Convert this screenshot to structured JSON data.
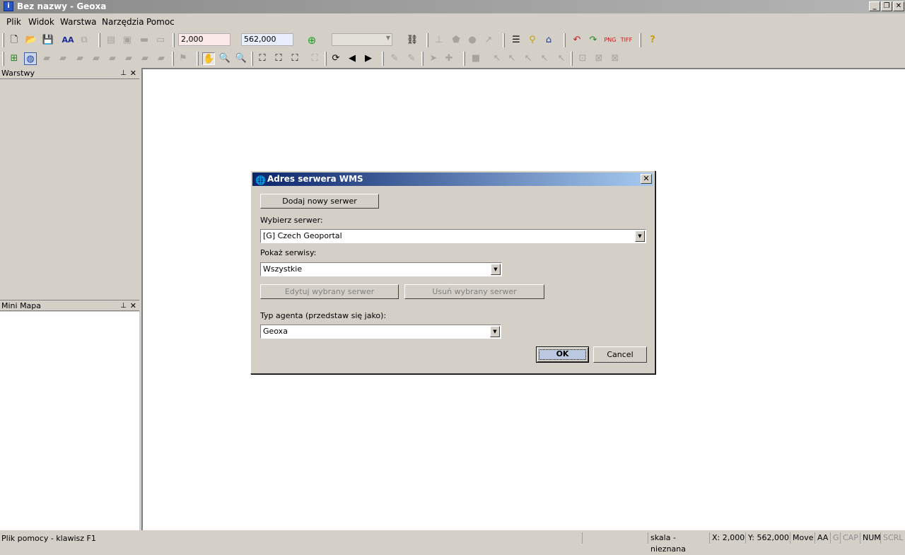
{
  "window": {
    "title": "Bez nazwy - Geoxa",
    "controls": {
      "minimize": "_",
      "restore": "❐",
      "close": "✕"
    }
  },
  "menu": [
    {
      "label": "Plik"
    },
    {
      "label": "Widok"
    },
    {
      "label": "Warstwa"
    },
    {
      "label": "Narzędzia"
    },
    {
      "label": "Pomoc"
    }
  ],
  "toolbar": {
    "scale_value": "2,000",
    "second_value": "562,000",
    "layer_combo": ""
  },
  "panels": {
    "layers_title": "Warstwy",
    "minimap_title": "Mini Mapa",
    "pin": "ᵖ",
    "close": "✕"
  },
  "dialog": {
    "title": "Adres serwera WMS",
    "close": "✕",
    "add_server_button": "Dodaj nowy serwer",
    "select_server_label": "Wybierz serwer:",
    "selected_server": "[G] Czech Geoportal",
    "show_services_label": "Pokaż serwisy:",
    "selected_services": "Wszystkie",
    "edit_button": "Edytuj wybrany serwer",
    "delete_button": "Usuń wybrany serwer",
    "agent_label": "Typ agenta (przedstaw się jako):",
    "selected_agent": "Geoxa",
    "ok_button": "OK",
    "cancel_button": "Cancel"
  },
  "status": {
    "help": "Plik pomocy - klawisz F1",
    "scale": "skala - nieznana",
    "x": "X: 2,000",
    "y": "Y: 562,000",
    "mode": "Move",
    "aa": "AA",
    "g": "G",
    "cap": "CAP",
    "num": "NUM",
    "scrl": "SCRL"
  }
}
